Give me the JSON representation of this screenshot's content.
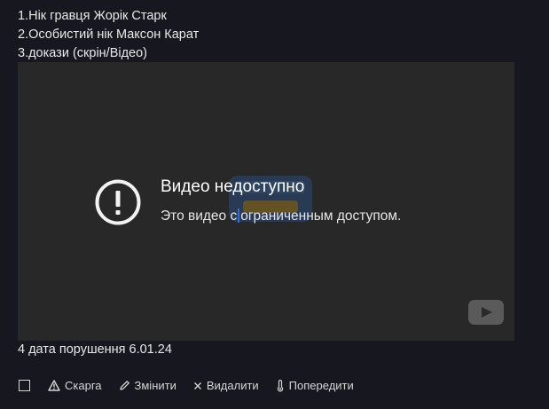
{
  "post": {
    "line1": "1.Нік гравця Жорік Старк",
    "line2": "2.Особистий нік Максон Карат",
    "line3": "3.докази (скрін/Відео)",
    "date_line": "4 дата порушення 6.01.24"
  },
  "video": {
    "error_title": "Видео недоступно",
    "error_subtitle_part1": "Это видео с",
    "error_subtitle_part2": "ограниченным доступом.",
    "icon": "error-circle-icon",
    "logo_icon": "youtube-play-icon"
  },
  "actions": {
    "report": "Скарга",
    "edit": "Змінити",
    "delete": "Видалити",
    "warn": "Попередити"
  },
  "colors": {
    "background": "#17181f",
    "video_bg": "#282828",
    "text": "#e6e6e6"
  }
}
